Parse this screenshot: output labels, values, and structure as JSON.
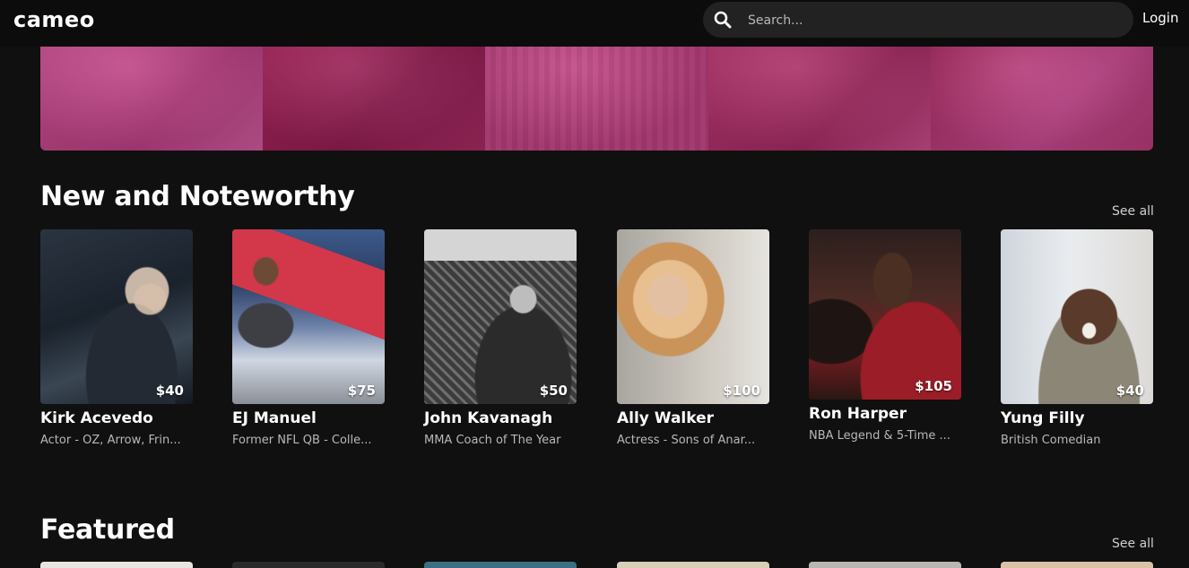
{
  "header": {
    "logo": "cameo",
    "search_placeholder": "Search...",
    "login_label": "Login"
  },
  "sections": [
    {
      "title": "New and Noteworthy",
      "see_all": "See all",
      "cards": [
        {
          "name": "Kirk Acevedo",
          "description": "Actor - OZ, Arrow, Frin...",
          "price": "$40"
        },
        {
          "name": "EJ Manuel",
          "description": "Former NFL QB - Colle...",
          "price": "$75"
        },
        {
          "name": "John Kavanagh",
          "description": "MMA Coach of The Year",
          "price": "$50"
        },
        {
          "name": "Ally Walker",
          "description": "Actress - Sons of Anar...",
          "price": "$100"
        },
        {
          "name": "Ron Harper",
          "description": "NBA Legend & 5-Time ...",
          "price": "$105"
        },
        {
          "name": "Yung Filly",
          "description": "British Comedian",
          "price": "$40"
        }
      ]
    },
    {
      "title": "Featured",
      "see_all": "See all"
    }
  ],
  "colors": {
    "background": "#101010",
    "hero_pink": "#b63d7f",
    "muted_text": "#b8b8b8"
  }
}
